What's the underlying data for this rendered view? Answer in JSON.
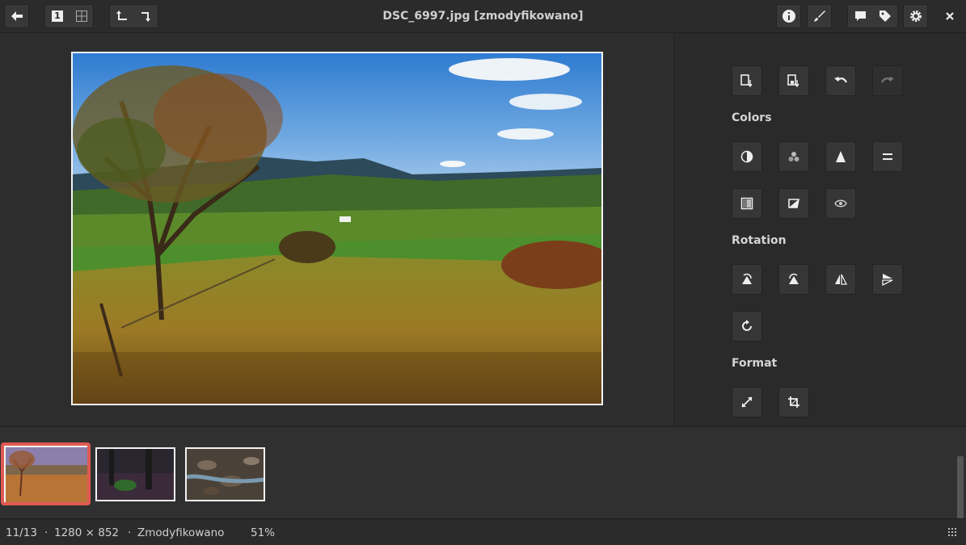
{
  "window": {
    "title": "DSC_6997.jpg [zmodyfikowano]"
  },
  "header": {
    "back_icon": "arrow-left-icon",
    "single_view_icon": "single-view-icon",
    "single_view_label": "1",
    "grid_view_icon": "grid-view-icon",
    "undo_icon": "undo-icon",
    "redo_icon": "redo-icon",
    "info_icon": "info-icon",
    "edit_icon": "brush-icon",
    "comment_icon": "comment-icon",
    "tag_icon": "tag-icon",
    "settings_icon": "gear-icon",
    "close_icon": "close-icon"
  },
  "panel": {
    "top_tools": [
      "save-icon",
      "save-as-icon",
      "undo-icon",
      "redo-icon"
    ],
    "sections": {
      "colors": "Colors",
      "rotation": "Rotation",
      "format": "Format"
    }
  },
  "filmstrip": {
    "thumbnails": [
      {
        "name": "autumn-landscape",
        "selected": true
      },
      {
        "name": "forest-dark",
        "selected": false
      },
      {
        "name": "stream-rocks",
        "selected": false
      }
    ],
    "selection_color": "#e05a52"
  },
  "status": {
    "position": "11/13",
    "separator": "·",
    "dimensions": "1280 × 852",
    "state": "Zmodyfikowano",
    "zoom": "51%"
  }
}
